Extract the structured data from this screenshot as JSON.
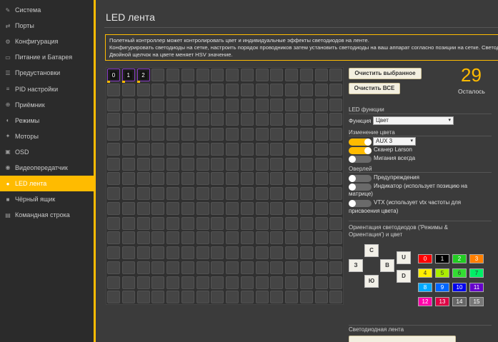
{
  "sidebar": {
    "items": [
      {
        "label": "Система",
        "icon": "wrench-icon",
        "glyph": "✎"
      },
      {
        "label": "Порты",
        "icon": "plug-icon",
        "glyph": "⇄"
      },
      {
        "label": "Конфигурация",
        "icon": "gear-icon",
        "glyph": "⚙"
      },
      {
        "label": "Питание и Батарея",
        "icon": "battery-icon",
        "glyph": "▭"
      },
      {
        "label": "Предустановки",
        "icon": "presets-icon",
        "glyph": "☰"
      },
      {
        "label": "PID настройки",
        "icon": "sliders-icon",
        "glyph": "≡"
      },
      {
        "label": "Приёмник",
        "icon": "receiver-icon",
        "glyph": "⊕"
      },
      {
        "label": "Режимы",
        "icon": "modes-icon",
        "glyph": "◐"
      },
      {
        "label": "Моторы",
        "icon": "motor-icon",
        "glyph": "✦"
      },
      {
        "label": "OSD",
        "icon": "osd-icon",
        "glyph": "▣"
      },
      {
        "label": "Видеопередатчик",
        "icon": "vtx-icon",
        "glyph": "◉"
      },
      {
        "label": "LED лента",
        "icon": "led-icon",
        "glyph": "●",
        "active": true
      },
      {
        "label": "Чёрный ящик",
        "icon": "blackbox-icon",
        "glyph": "■"
      },
      {
        "label": "Командная строка",
        "icon": "cli-icon",
        "glyph": "▤"
      }
    ],
    "accent": "#ffbb00"
  },
  "page": {
    "title": "LED лента",
    "note_lines": [
      "Полетный контроллер может контролировать цвет и индивидуальные эффекты светодиодов на ленте.",
      "Конфигурировать светодиоды на сетке, настроить порядок проводников затем установить светодиоды на ваш аппарат согласно позиции на сетке. Светодиоды без провода будут игнорироваться.",
      "Двойной щелчок на цвете меняет HSV значение."
    ]
  },
  "grid": {
    "columns": 16,
    "rows": 16,
    "wired_leds": [
      "0",
      "1",
      "2"
    ]
  },
  "controls": {
    "clear_selected": "Очистить выбранное",
    "clear_all": "Очистить ВСЕ",
    "remaining_count": "29",
    "remaining_label": "Осталось",
    "led_functions_title": "LED функции",
    "function_label": "Функция",
    "function_value": "Цвет",
    "color_change_title": "Изменение цвета",
    "aux_value": "AUX 3",
    "larson_label": "Сканер Larson",
    "blink_label": "Мигания всегда",
    "overlay_title": "Оверлей",
    "warnings_label": "Предупреждения",
    "indicator_label_1": "Индикатор (использует позицию на",
    "indicator_label_2": "матрице)",
    "vtx_label_1": "VTX (использует vtx частоты для",
    "vtx_label_2": "присвоения цвета)",
    "orientation_title_1": "Ориентация светодиодов ('Режимы &",
    "orientation_title_2": "Ориентация') и цвет",
    "directions": {
      "n": "С",
      "w": "З",
      "e": "В",
      "s": "Ю",
      "up": "U",
      "down": "D"
    },
    "strip_title": "Светодиодная лента",
    "toggles": {
      "aux": true,
      "larson": true,
      "blink": false,
      "warnings": false,
      "indicator": false,
      "vtx": false
    }
  },
  "colors": [
    {
      "label": "0",
      "hex": "#ff0000"
    },
    {
      "label": "1",
      "hex": "#000000"
    },
    {
      "label": "2",
      "hex": "#22cc22"
    },
    {
      "label": "3",
      "hex": "#ff7f00"
    },
    {
      "label": "4",
      "hex": "#ffee00"
    },
    {
      "label": "5",
      "hex": "#aaee00"
    },
    {
      "label": "6",
      "hex": "#33dd33"
    },
    {
      "label": "7",
      "hex": "#00ee66"
    },
    {
      "label": "8",
      "hex": "#00aaff"
    },
    {
      "label": "9",
      "hex": "#0066ff"
    },
    {
      "label": "10",
      "hex": "#0000ee"
    },
    {
      "label": "11",
      "hex": "#6600cc"
    },
    {
      "label": "12",
      "hex": "#ff00aa"
    },
    {
      "label": "13",
      "hex": "#dd0044"
    },
    {
      "label": "14",
      "hex": "#666666"
    },
    {
      "label": "15",
      "hex": "#777777"
    }
  ]
}
